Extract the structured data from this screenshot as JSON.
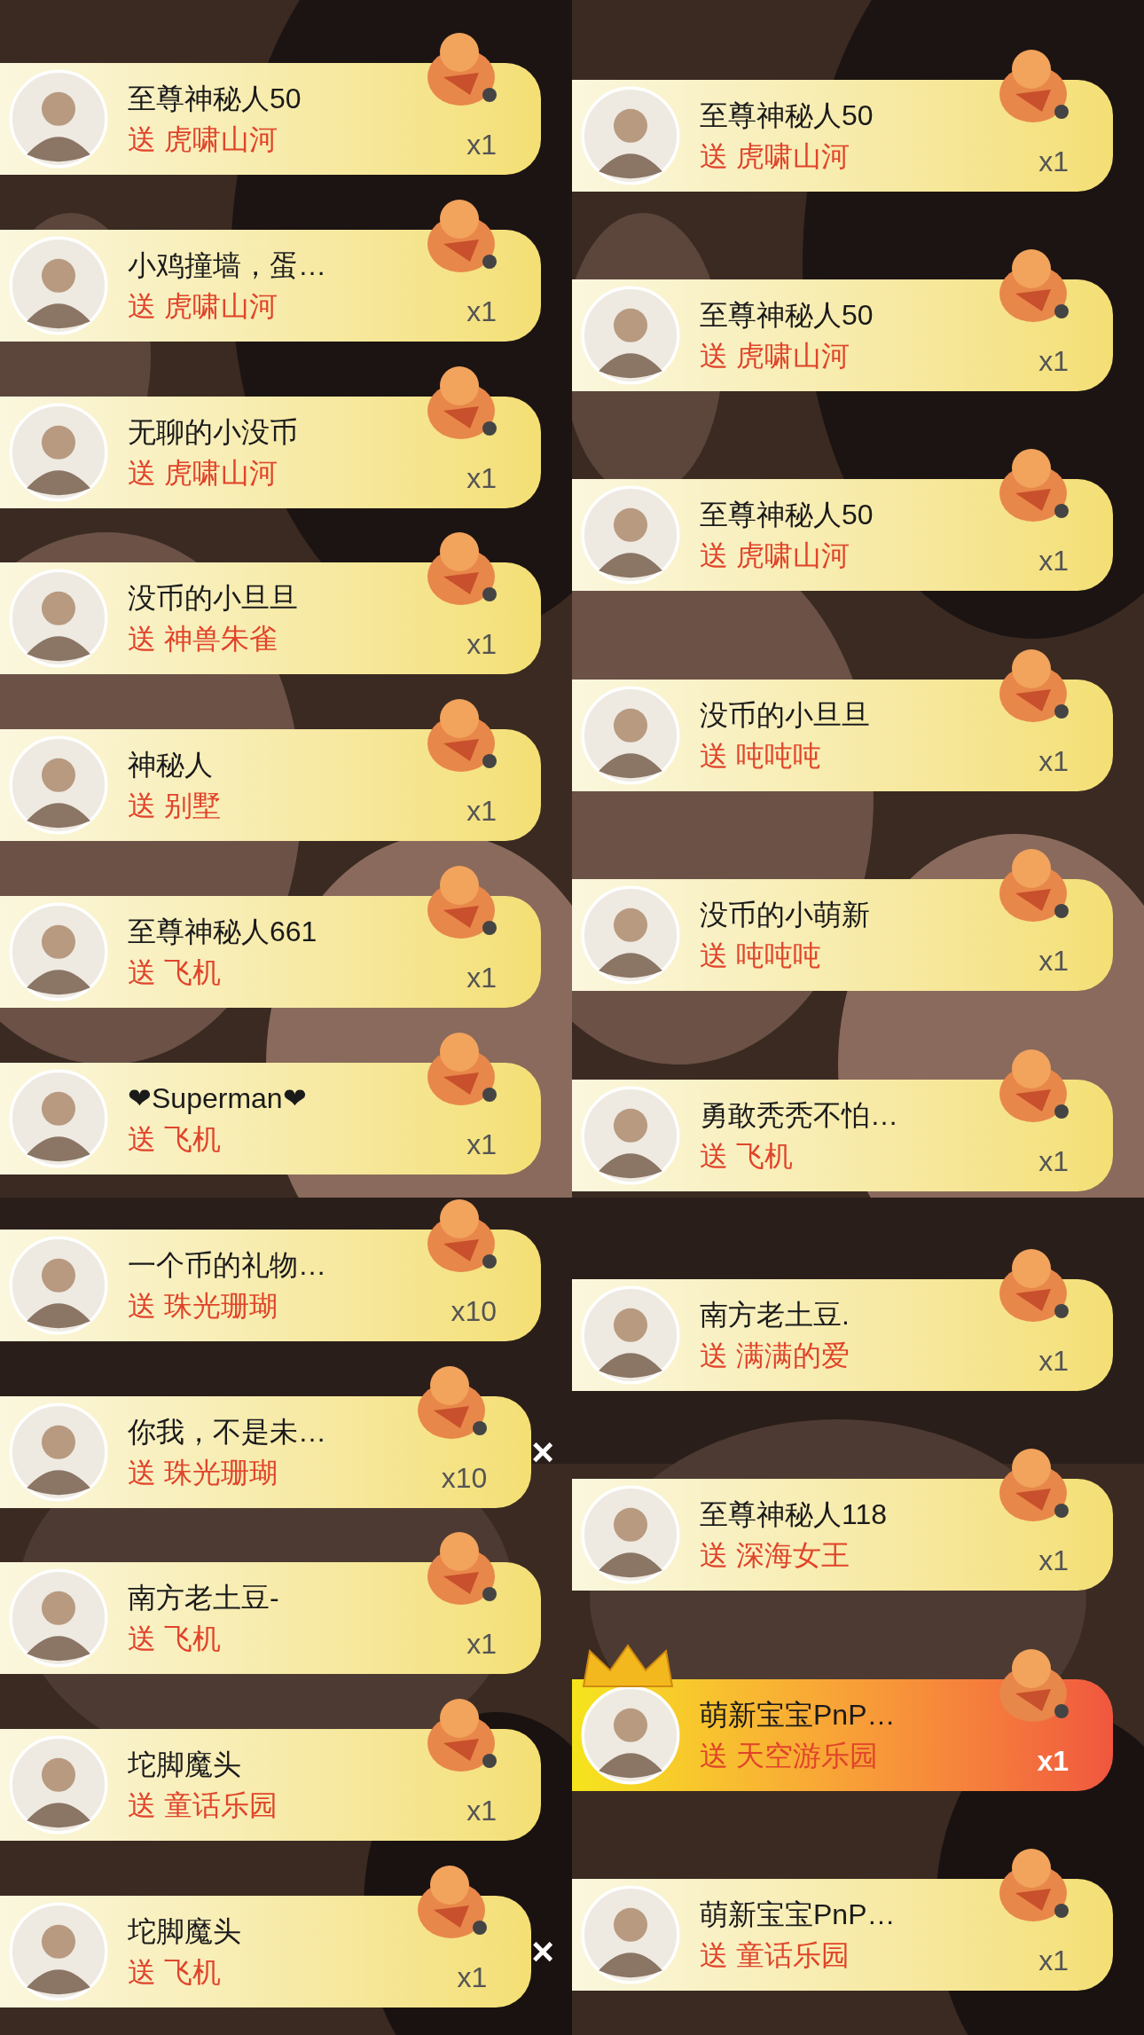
{
  "columns": [
    {
      "items": [
        {
          "name": "至尊神秘人50",
          "gift": "送 虎啸山河",
          "count": "x1",
          "highlighted": false
        },
        {
          "name": "小鸡撞墙，蛋…",
          "gift": "送 虎啸山河",
          "count": "x1",
          "highlighted": false
        },
        {
          "name": "无聊的小没币",
          "gift": "送 虎啸山河",
          "count": "x1",
          "highlighted": false
        },
        {
          "name": "没币的小旦旦",
          "gift": "送 神兽朱雀",
          "count": "x1",
          "highlighted": false
        },
        {
          "name": "神秘人",
          "gift": "送 别墅",
          "count": "x1",
          "highlighted": false
        },
        {
          "name": "至尊神秘人661",
          "gift": "送 飞机",
          "count": "x1",
          "highlighted": false
        },
        {
          "name": "❤Superman❤",
          "gift": "送 飞机",
          "count": "x1",
          "highlighted": false
        },
        {
          "name": "一个币的礼物…",
          "gift": "送 珠光珊瑚",
          "count": "x10",
          "highlighted": false
        },
        {
          "name": "你我，不是未…",
          "gift": "送 珠光珊瑚",
          "count": "x10",
          "highlighted": false,
          "close": "×"
        },
        {
          "name": "南方老土豆-",
          "gift": "送 飞机",
          "count": "x1",
          "highlighted": false
        },
        {
          "name": "坨脚魔头",
          "gift": "送 童话乐园",
          "count": "x1",
          "highlighted": false
        },
        {
          "name": "坨脚魔头",
          "gift": "送 飞机",
          "count": "x1",
          "highlighted": false,
          "close": "×"
        }
      ]
    },
    {
      "items": [
        {
          "name": "至尊神秘人50",
          "gift": "送 虎啸山河",
          "count": "x1",
          "highlighted": false
        },
        {
          "name": "至尊神秘人50",
          "gift": "送 虎啸山河",
          "count": "x1",
          "highlighted": false
        },
        {
          "name": "至尊神秘人50",
          "gift": "送 虎啸山河",
          "count": "x1",
          "highlighted": false
        },
        {
          "name": "没币的小旦旦",
          "gift": "送 吨吨吨",
          "count": "x1",
          "highlighted": false
        },
        {
          "name": "没币的小萌新",
          "gift": "送 吨吨吨",
          "count": "x1",
          "highlighted": false
        },
        {
          "name": "勇敢秃秃不怕…",
          "gift": "送 飞机",
          "count": "x1",
          "highlighted": false
        },
        {
          "name": "南方老土豆.",
          "gift": "送 满满的爱",
          "count": "x1",
          "highlighted": false
        },
        {
          "name": "至尊神秘人118",
          "gift": "送 深海女王",
          "count": "x1",
          "highlighted": false
        },
        {
          "name": "萌新宝宝PnP…",
          "gift": "送 天空游乐园",
          "count": "x1",
          "highlighted": true
        },
        {
          "name": "萌新宝宝PnP…",
          "gift": "送 童话乐园",
          "count": "x1",
          "highlighted": false
        }
      ]
    }
  ]
}
